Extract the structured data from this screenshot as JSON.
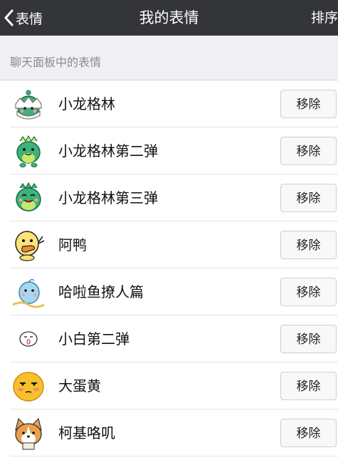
{
  "navbar": {
    "back_label": "表情",
    "title": "我的表情",
    "sort_label": "排序"
  },
  "section_header": "聊天面板中的表情",
  "remove_label": "移除",
  "stickers": [
    {
      "name": "小龙格林",
      "icon": "green-dragon-eggshell-icon"
    },
    {
      "name": "小龙格林第二弹",
      "icon": "green-dragon-icon"
    },
    {
      "name": "小龙格林第三弹",
      "icon": "green-dragon-smiling-icon"
    },
    {
      "name": "阿鸭",
      "icon": "yellow-duck-icon"
    },
    {
      "name": "哈啦鱼撩人篇",
      "icon": "blue-fish-icon"
    },
    {
      "name": "小白第二弹",
      "icon": "white-face-icon"
    },
    {
      "name": "大蛋黄",
      "icon": "egg-yolk-face-icon"
    },
    {
      "name": "柯基咯叽",
      "icon": "corgi-dog-icon"
    }
  ]
}
